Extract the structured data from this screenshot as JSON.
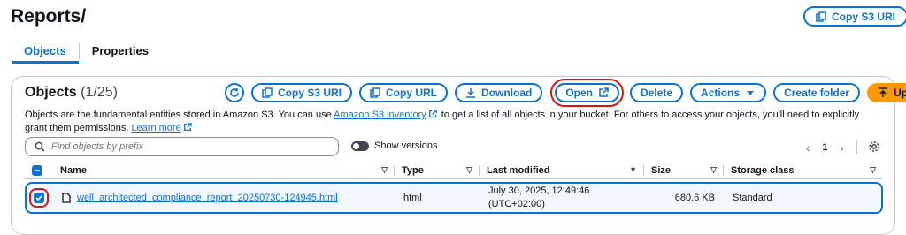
{
  "page": {
    "title": "Reports/",
    "copy_s3_uri": "Copy S3 URI"
  },
  "tabs": [
    {
      "label": "Objects"
    },
    {
      "label": "Properties"
    }
  ],
  "objects": {
    "title": "Objects",
    "count": "(1/25)",
    "toolbar": {
      "copy_s3_uri": "Copy S3 URI",
      "copy_url": "Copy URL",
      "download": "Download",
      "open": "Open",
      "delete": "Delete",
      "actions": "Actions",
      "create_folder": "Create folder",
      "upload": "Upload"
    },
    "description": {
      "part1": "Objects are the fundamental entities stored in Amazon S3. You can use ",
      "inventory_link": "Amazon S3 inventory",
      "part2": " to get a list of all objects in your bucket. For others to access your objects, you'll need to explicitly grant them permissions. ",
      "learn_more": "Learn more"
    },
    "search": {
      "placeholder": "Find objects by prefix"
    },
    "show_versions": "Show versions",
    "pagination": {
      "page": "1"
    },
    "columns": [
      "Name",
      "Type",
      "Last modified",
      "Size",
      "Storage class"
    ],
    "rows": [
      {
        "name": "well_architected_compliance_report_20250730-124945.html",
        "type": "html",
        "last_modified_line1": "July 30, 2025, 12:49:46",
        "last_modified_line2": "(UTC+02:00)",
        "size": "680.6 KB",
        "storage_class": "Standard"
      }
    ]
  },
  "colors": {
    "accent": "#0972d3",
    "upload": "#ff9900",
    "highlight": "#d91515"
  }
}
